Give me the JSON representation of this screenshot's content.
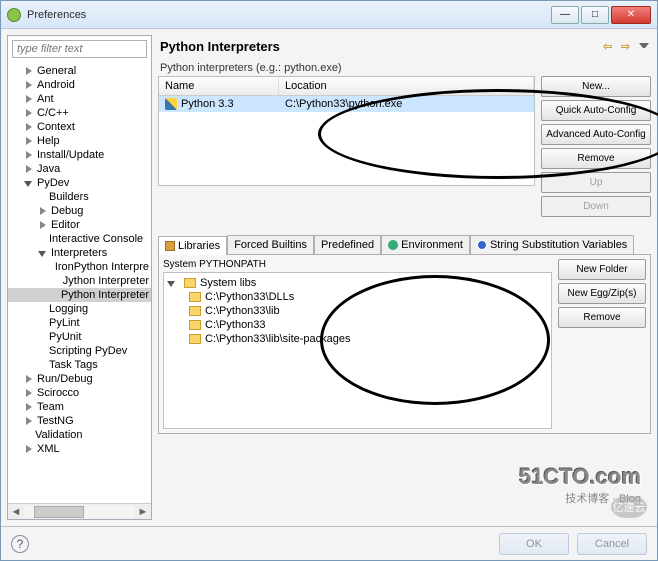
{
  "window": {
    "title": "Preferences"
  },
  "filter": {
    "placeholder": "type filter text"
  },
  "tree": {
    "items": [
      {
        "label": "General",
        "level": 1,
        "open": false
      },
      {
        "label": "Android",
        "level": 1,
        "open": false
      },
      {
        "label": "Ant",
        "level": 1,
        "open": false
      },
      {
        "label": "C/C++",
        "level": 1,
        "open": false
      },
      {
        "label": "Context",
        "level": 1,
        "open": false
      },
      {
        "label": "Help",
        "level": 1,
        "open": false
      },
      {
        "label": "Install/Update",
        "level": 1,
        "open": false
      },
      {
        "label": "Java",
        "level": 1,
        "open": false
      },
      {
        "label": "PyDev",
        "level": 1,
        "open": true
      },
      {
        "label": "Builders",
        "level": 2,
        "leaf": true
      },
      {
        "label": "Debug",
        "level": 2,
        "open": false
      },
      {
        "label": "Editor",
        "level": 2,
        "open": false
      },
      {
        "label": "Interactive Console",
        "level": 2,
        "leaf": true
      },
      {
        "label": "Interpreters",
        "level": 2,
        "open": true
      },
      {
        "label": "IronPython Interpre",
        "level": 3,
        "leaf": true
      },
      {
        "label": "Jython Interpreter",
        "level": 3,
        "leaf": true
      },
      {
        "label": "Python Interpreter",
        "level": 3,
        "leaf": true,
        "selected": true
      },
      {
        "label": "Logging",
        "level": 2,
        "leaf": true
      },
      {
        "label": "PyLint",
        "level": 2,
        "leaf": true
      },
      {
        "label": "PyUnit",
        "level": 2,
        "leaf": true
      },
      {
        "label": "Scripting PyDev",
        "level": 2,
        "leaf": true
      },
      {
        "label": "Task Tags",
        "level": 2,
        "leaf": true
      },
      {
        "label": "Run/Debug",
        "level": 1,
        "open": false
      },
      {
        "label": "Scirocco",
        "level": 1,
        "open": false
      },
      {
        "label": "Team",
        "level": 1,
        "open": false
      },
      {
        "label": "TestNG",
        "level": 1,
        "open": false
      },
      {
        "label": "Validation",
        "level": 1,
        "leaf": true
      },
      {
        "label": "XML",
        "level": 1,
        "open": false
      }
    ]
  },
  "page": {
    "heading": "Python Interpreters",
    "section_label": "Python interpreters (e.g.: python.exe)",
    "table": {
      "headers": {
        "name": "Name",
        "location": "Location"
      },
      "rows": [
        {
          "name": "Python 3.3",
          "location": "C:\\Python33\\python.exe"
        }
      ]
    },
    "buttons": {
      "new": "New...",
      "auto": "Quick Auto-Config",
      "adv": "Advanced Auto-Config",
      "remove": "Remove",
      "up": "Up",
      "down": "Down"
    },
    "tabs": {
      "libraries": "Libraries",
      "forced": "Forced Builtins",
      "predefined": "Predefined",
      "environment": "Environment",
      "substitution": "String Substitution Variables"
    },
    "lib_section": "System PYTHONPATH",
    "lib_root": "System libs",
    "lib_paths": [
      "C:\\Python33\\DLLs",
      "C:\\Python33\\lib",
      "C:\\Python33",
      "C:\\Python33\\lib\\site-packages"
    ],
    "lib_buttons": {
      "new_folder": "New Folder",
      "new_egg": "New Egg/Zip(s)",
      "remove": "Remove"
    }
  },
  "footer": {
    "ok": "OK",
    "cancel": "Cancel"
  },
  "watermark": {
    "big": "51CTO.com",
    "small": "技术博客 · Blog",
    "cloud": "亿速云"
  }
}
